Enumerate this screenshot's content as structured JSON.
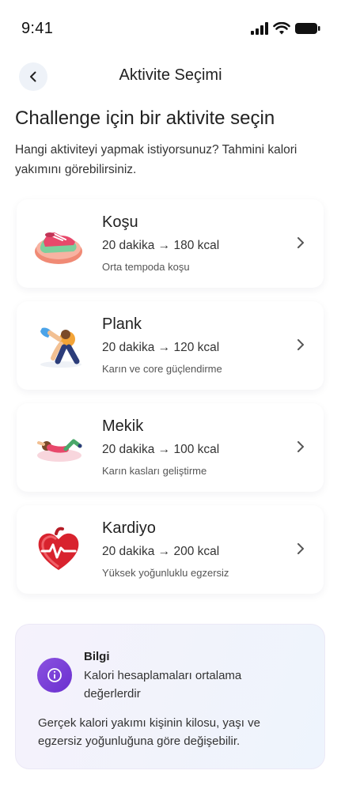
{
  "status_bar": {
    "time": "9:41"
  },
  "nav": {
    "title": "Aktivite Seçimi"
  },
  "heading": "Challenge için bir aktivite seçin",
  "subtitle": "Hangi aktiviteyi yapmak istiyorsunuz? Tahmini kalori yakımını görebilirsiniz.",
  "activities": [
    {
      "title": "Koşu",
      "kcal": "20 dakika → 180 kcal",
      "desc": "Orta tempoda koşu",
      "icon": "running-shoe-icon"
    },
    {
      "title": "Plank",
      "kcal": "20 dakika → 120 kcal",
      "desc": "Karın ve core güçlendirme",
      "icon": "plank-person-icon"
    },
    {
      "title": "Mekik",
      "kcal": "20 dakika → 100 kcal",
      "desc": "Karın kasları geliştirme",
      "icon": "situp-person-icon"
    },
    {
      "title": "Kardiyo",
      "kcal": "20 dakika → 200 kcal",
      "desc": "Yüksek yoğunluklu egzersiz",
      "icon": "heart-pulse-icon"
    }
  ],
  "info": {
    "title": "Bilgi",
    "lead": "Kalori hesaplamaları ortalama değerlerdir",
    "body": "Gerçek kalori yakımı kişinin kilosu, yaşı ve egzersiz yoğunluğuna göre değişebilir.",
    "icon": "info-icon"
  },
  "colors": {
    "accent": "#7b3fd8",
    "card_bg": "#ffffff",
    "info_bg": "#f3f2fb"
  }
}
